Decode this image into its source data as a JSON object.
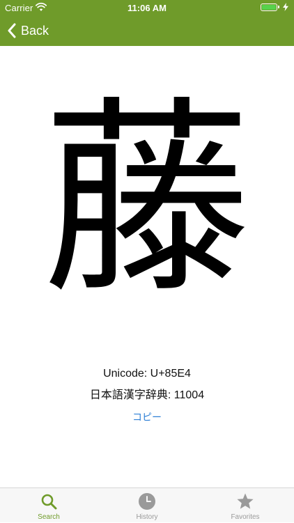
{
  "status_bar": {
    "carrier": "Carrier",
    "time": "11:06 AM"
  },
  "nav": {
    "back_label": "Back"
  },
  "main": {
    "kanji": "藤",
    "unicode_line": "Unicode: U+85E4",
    "dictionary_line": "日本語漢字辞典: 11004",
    "copy_label": "コピー"
  },
  "tabs": [
    {
      "label": "Search",
      "icon": "search-icon",
      "active": true
    },
    {
      "label": "History",
      "icon": "clock-icon",
      "active": false
    },
    {
      "label": "Favorites",
      "icon": "star-icon",
      "active": false
    }
  ],
  "colors": {
    "nav_green": "#6f9b2a",
    "link_blue": "#2f80d6",
    "tab_inactive": "#9a9a9a"
  }
}
